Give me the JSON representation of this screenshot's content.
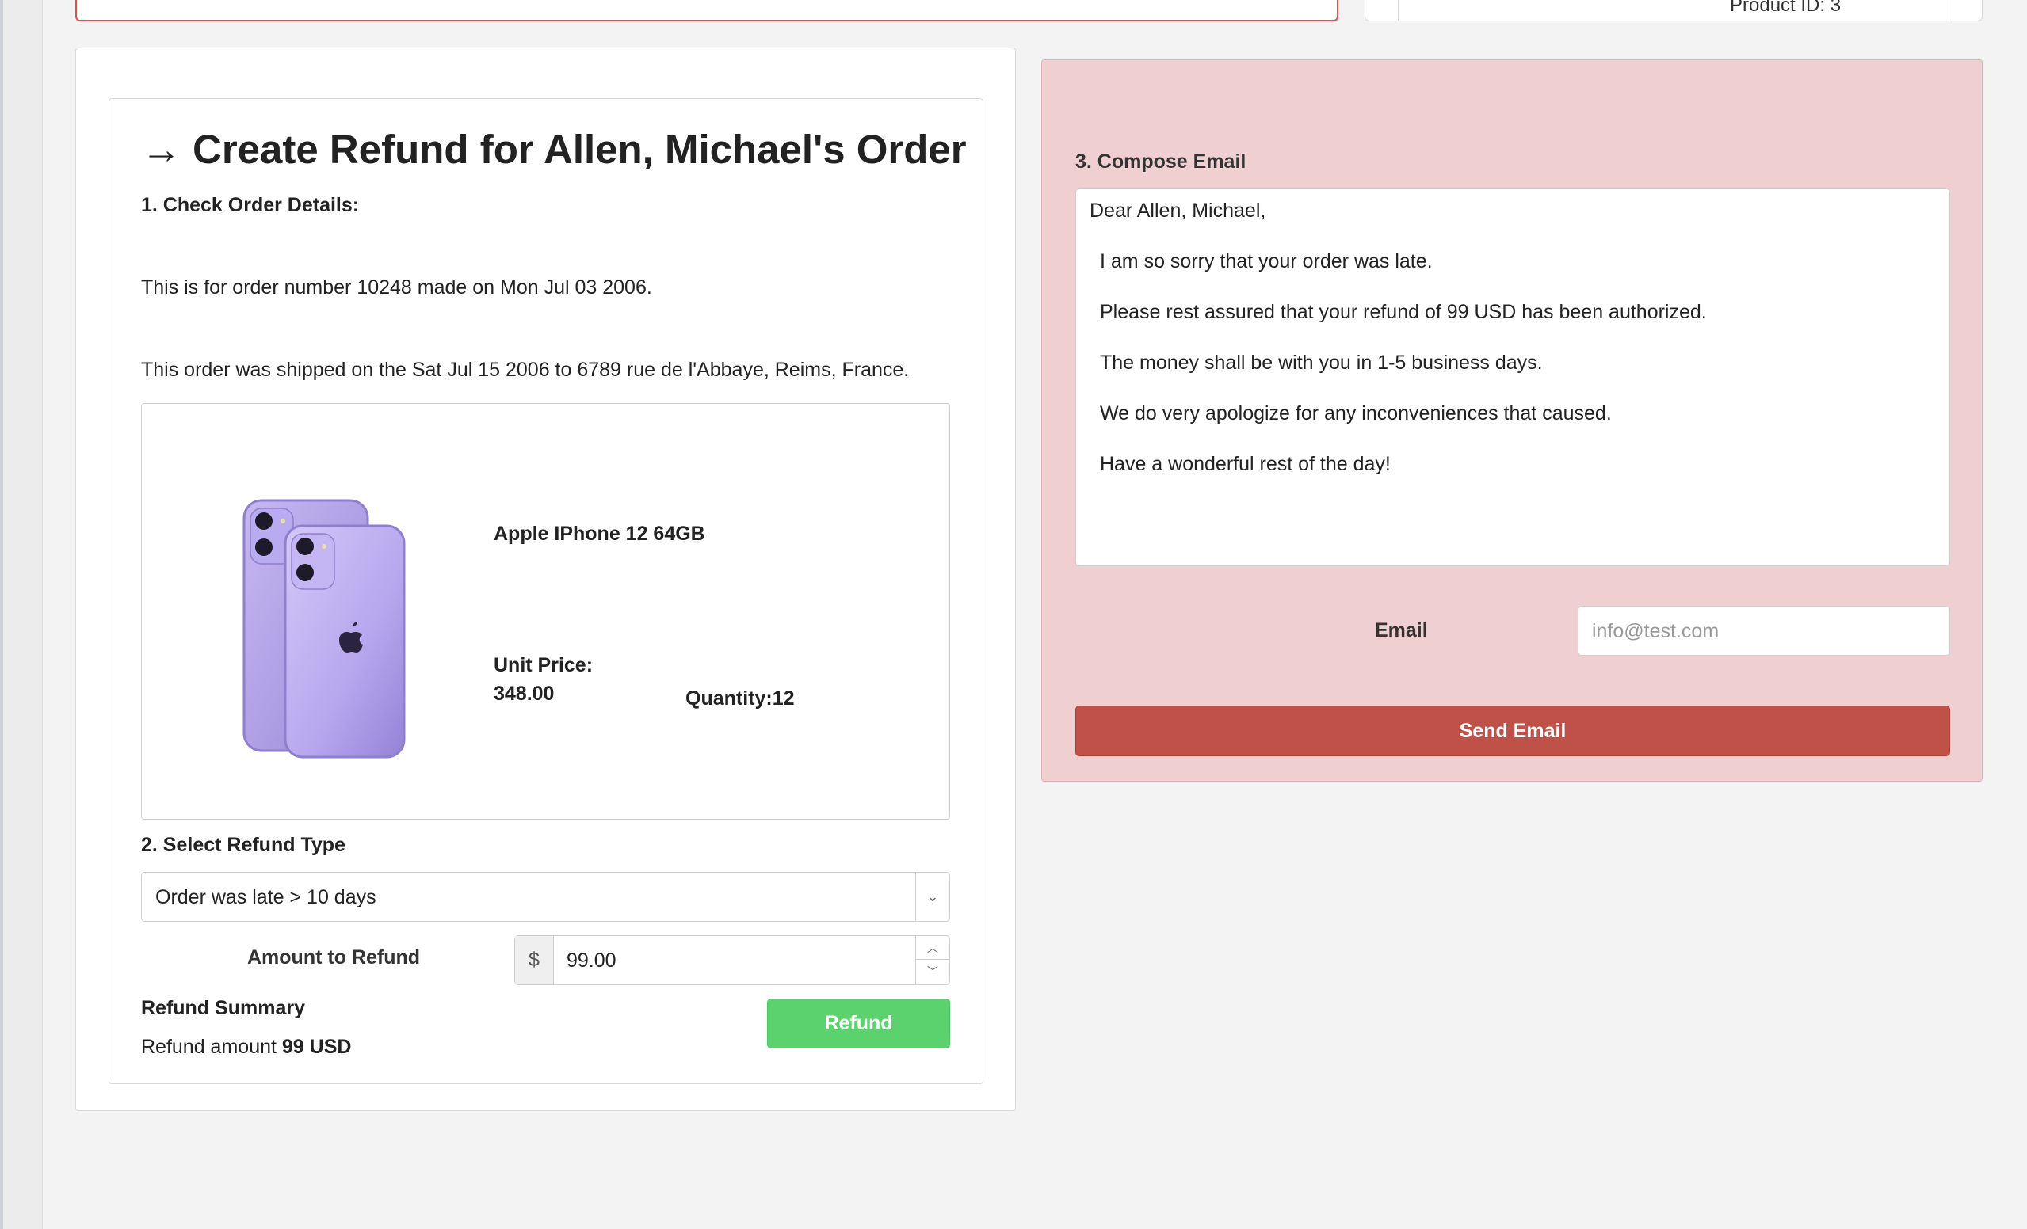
{
  "top": {
    "product_id": "Product ID: 3"
  },
  "refund": {
    "title": "Create Refund for Allen, Michael's Order",
    "step1": "1. Check Order Details:",
    "order_line": "This is for order number 10248 made on Mon Jul 03 2006.",
    "ship_line": "This order was shipped on the Sat Jul 15 2006 to 6789 rue de l'Abbaye, Reims, France.",
    "product": {
      "name": "Apple IPhone 12 64GB",
      "unit_price_label": "Unit Price:",
      "unit_price": "348.00",
      "quantity": "Quantity:12",
      "image_icon": "purple-iphone-image"
    },
    "step2": "2. Select Refund Type",
    "refund_type": "Order was late > 10 days",
    "amount_label": "Amount to Refund",
    "currency_symbol": "$",
    "amount_value": "99.00",
    "summary_title": "Refund Summary",
    "summary_prefix": "Refund amount",
    "summary_amount": "99 USD",
    "refund_button": "Refund"
  },
  "email": {
    "step3": "3. Compose Email",
    "lines": [
      "Dear Allen, Michael,",
      "I am so sorry that your order was late.",
      "Please rest assured that your refund of 99 USD has been authorized.",
      "The money shall be with you in 1-5 business days.",
      "We do very apologize for any inconveniences that caused.",
      "Have a wonderful rest of the day!"
    ],
    "email_label": "Email",
    "email_placeholder": "info@test.com",
    "send_button": "Send Email"
  },
  "colors": {
    "refund_button": "#5cd26f",
    "send_button": "#bf5148",
    "compose_panel": "#f0cfd0",
    "top_box_border": "#d9534f"
  }
}
